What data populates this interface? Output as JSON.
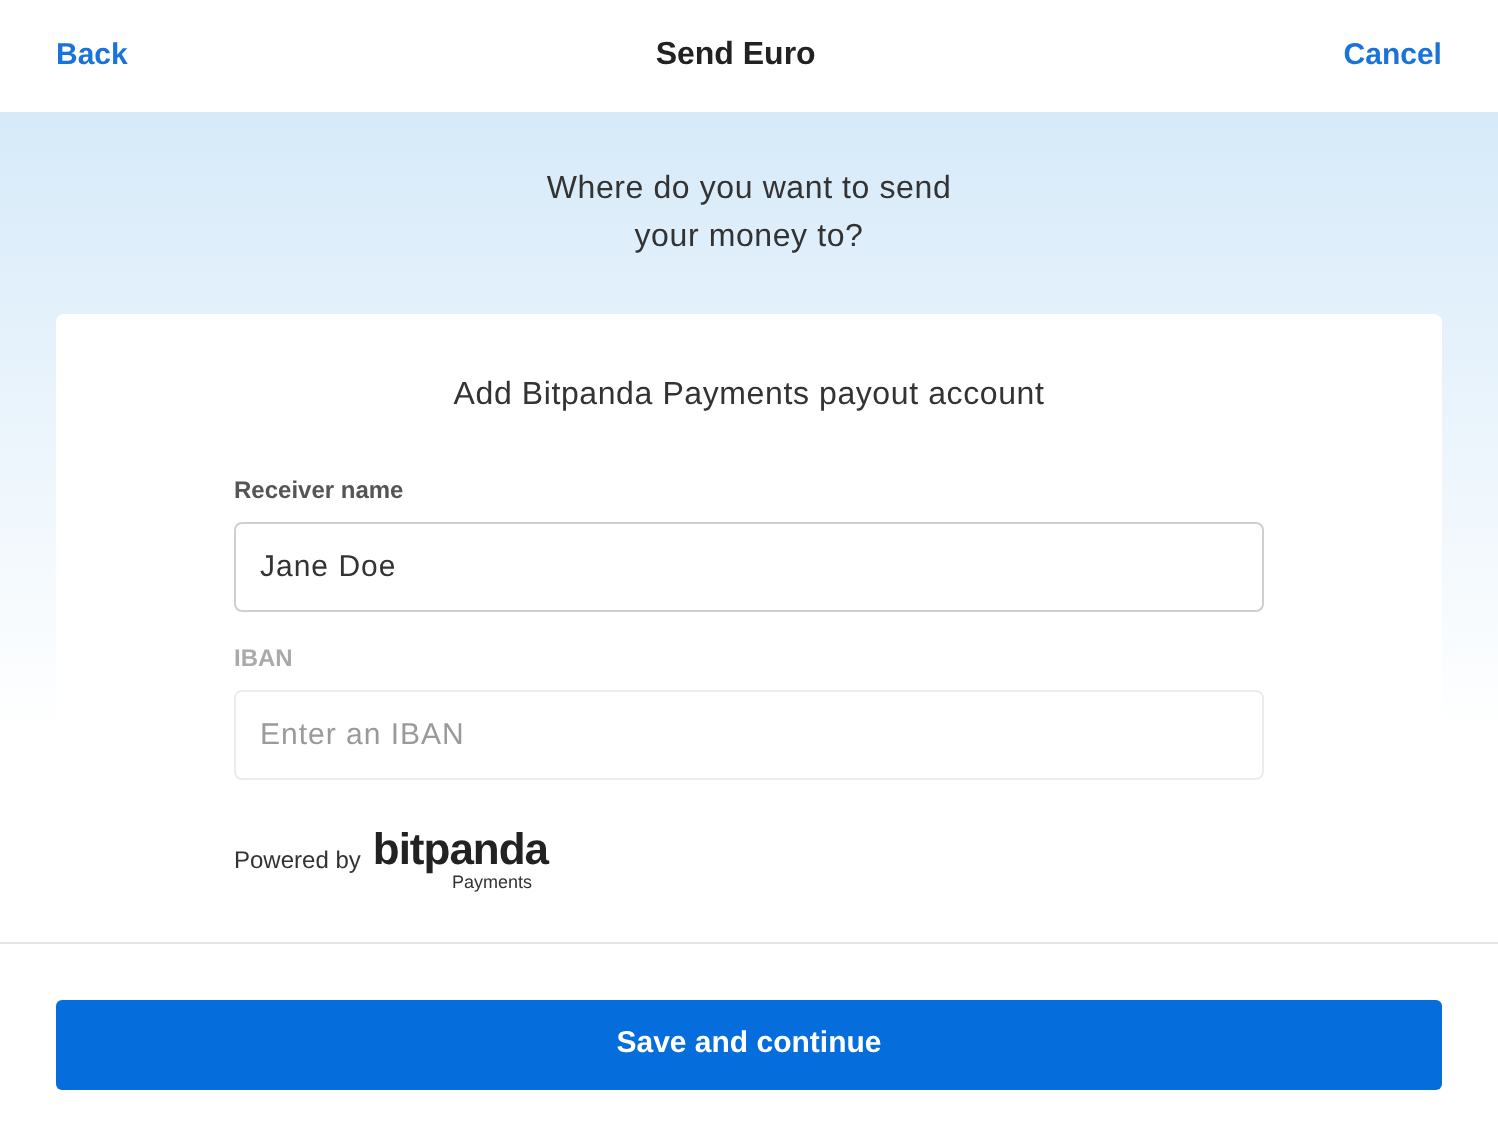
{
  "nav": {
    "back": "Back",
    "title": "Send Euro",
    "cancel": "Cancel"
  },
  "question": "Where do you want to send your money to?",
  "card": {
    "title": "Add Bitpanda Payments payout account",
    "fields": [
      {
        "label": "Receiver name",
        "value": "Jane Doe",
        "disabled": false
      },
      {
        "label": "IBAN",
        "placeholder": "Enter an IBAN",
        "disabled": true
      }
    ],
    "powered_by": {
      "text": "Powered by",
      "logo": "bitpanda",
      "logo_sub": "Payments"
    }
  },
  "primary_button": "Save and continue"
}
